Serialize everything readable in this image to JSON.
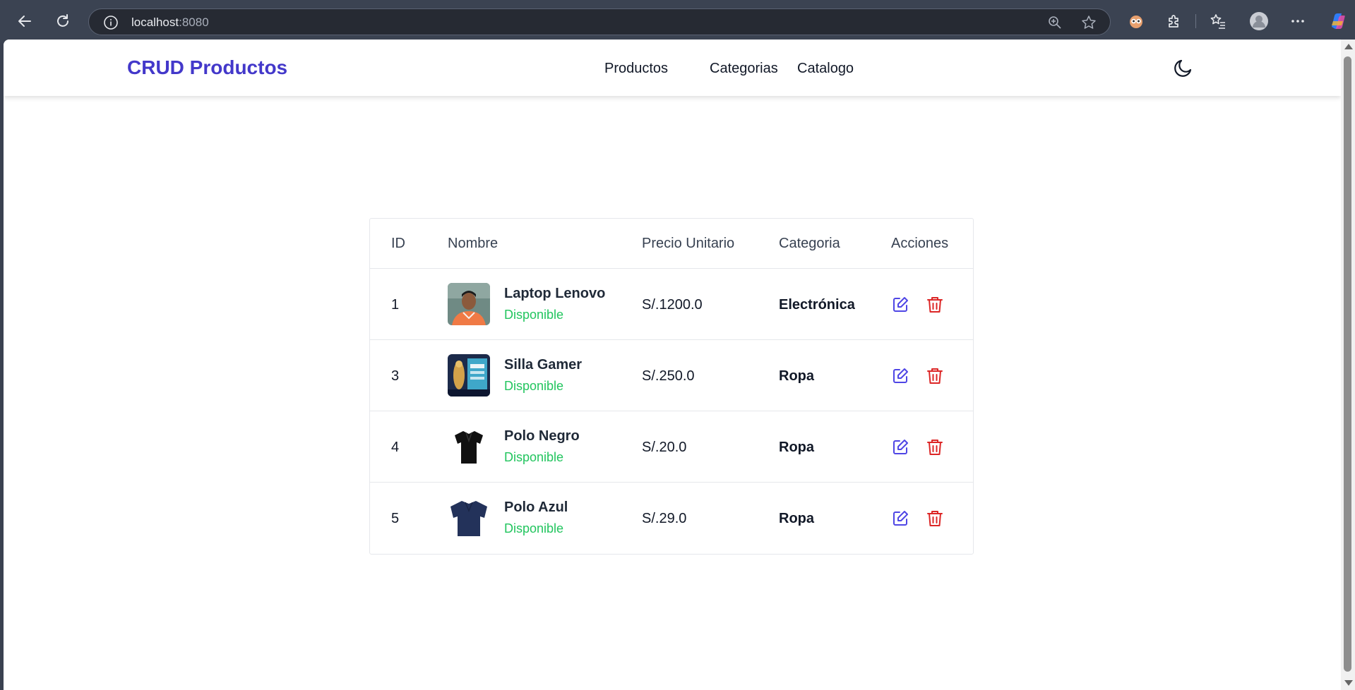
{
  "browser": {
    "url_host": "localhost",
    "url_port": ":8080"
  },
  "navbar": {
    "brand": "CRUD Productos",
    "links": [
      {
        "label": "Productos"
      },
      {
        "label": "Categorias"
      },
      {
        "label": "Catalogo"
      }
    ],
    "theme_icon": "moon-icon"
  },
  "table": {
    "headers": [
      "ID",
      "Nombre",
      "Precio Unitario",
      "Categoria",
      "Acciones"
    ],
    "rows": [
      {
        "id": "1",
        "name": "Laptop Lenovo",
        "status": "Disponible",
        "price": "S/.1200.0",
        "category": "Electrónica",
        "image": "person-photo"
      },
      {
        "id": "3",
        "name": "Silla Gamer",
        "status": "Disponible",
        "price": "S/.250.0",
        "category": "Ropa",
        "image": "game-poster"
      },
      {
        "id": "4",
        "name": "Polo Negro",
        "status": "Disponible",
        "price": "S/.20.0",
        "category": "Ropa",
        "image": "black-polo-shirt"
      },
      {
        "id": "5",
        "name": "Polo Azul",
        "status": "Disponible",
        "price": "S/.29.0",
        "category": "Ropa",
        "image": "blue-polo-shirt"
      }
    ]
  },
  "colors": {
    "brand": "#4338ca",
    "status_available": "#22c55e",
    "edit_icon": "#4f46e5",
    "delete_icon": "#dc2626"
  }
}
